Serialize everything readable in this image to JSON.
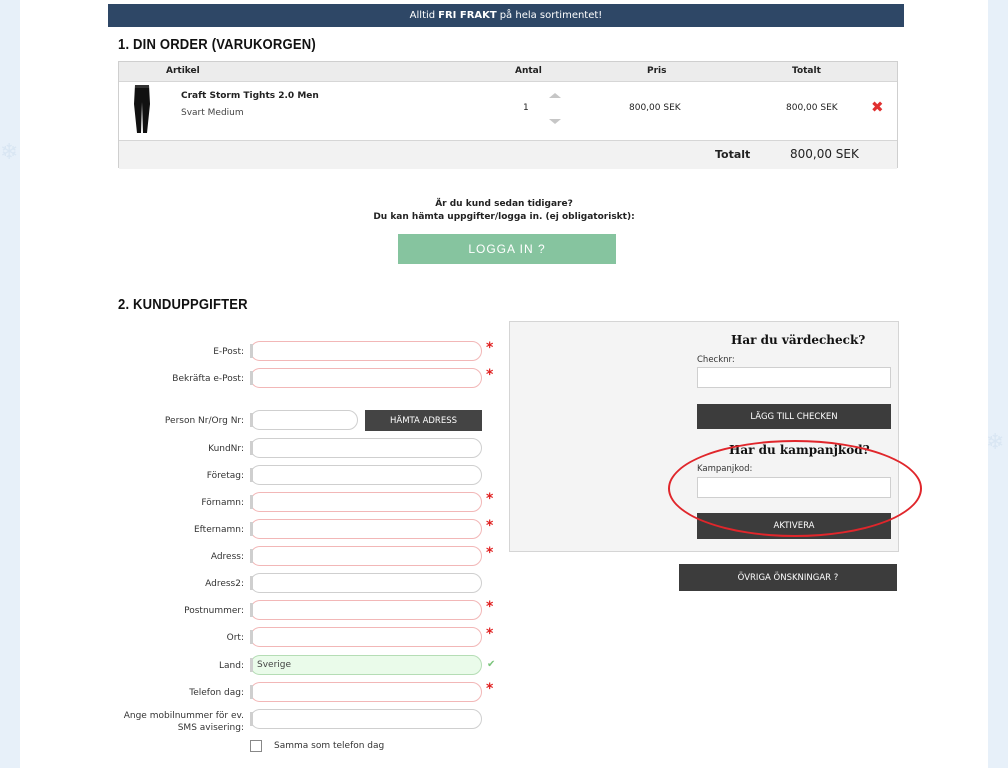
{
  "banner": {
    "pre": "Alltid",
    "bold": "FRI FRAKT",
    "post": "på hela sortimentet!"
  },
  "order": {
    "title": "1. DIN ORDER (VARUKORGEN)",
    "headers": {
      "article": "Artikel",
      "qty": "Antal",
      "price": "Pris",
      "total": "Totalt"
    },
    "item": {
      "name": "Craft Storm Tights 2.0 Men",
      "variant": "Svart Medium",
      "qty": "1",
      "price": "800,00 SEK",
      "total": "800,00 SEK"
    },
    "footer": {
      "label": "Totalt",
      "value": "800,00 SEK"
    }
  },
  "login": {
    "question": "Är du kund sedan tidigare?",
    "info": "Du kan hämta uppgifter/logga in. (ej obligatoriskt):",
    "button": "LOGGA IN ?"
  },
  "customer": {
    "title": "2. KUNDUPPGIFTER",
    "fields": {
      "email": "E-Post:",
      "email_confirm": "Bekräfta e-Post:",
      "personnr": "Person Nr/Org Nr:",
      "kundnr": "KundNr:",
      "company": "Företag:",
      "firstname": "Förnamn:",
      "lastname": "Efternamn:",
      "address": "Adress:",
      "address2": "Adress2:",
      "postcode": "Postnummer:",
      "city": "Ort:",
      "country": "Land:",
      "phone": "Telefon dag:",
      "mobile_line1": "Ange mobilnummer för ev.",
      "mobile_line2": "SMS avisering:"
    },
    "country_value": "Sverige",
    "fetch_address_button": "HÄMTA ADRESS",
    "same_phone_label": "Samma som telefon dag",
    "required_mark": "*",
    "valid_mark": "✔"
  },
  "voucher": {
    "heading": "Har du värdecheck?",
    "label": "Checknr:",
    "button": "LÄGG TILL CHECKEN"
  },
  "campaign": {
    "heading": "Har du kampanjkod?",
    "label": "Kampanjkod:",
    "button": "AKTIVERA"
  },
  "other_wishes_button": "ÖVRIGA ÖNSKNINGAR ?",
  "colors": {
    "banner": "#2e4766",
    "login_button": "#86c49f",
    "dark_button": "#3c3c3c",
    "required": "#e02020",
    "highlight": "#e0262b"
  }
}
